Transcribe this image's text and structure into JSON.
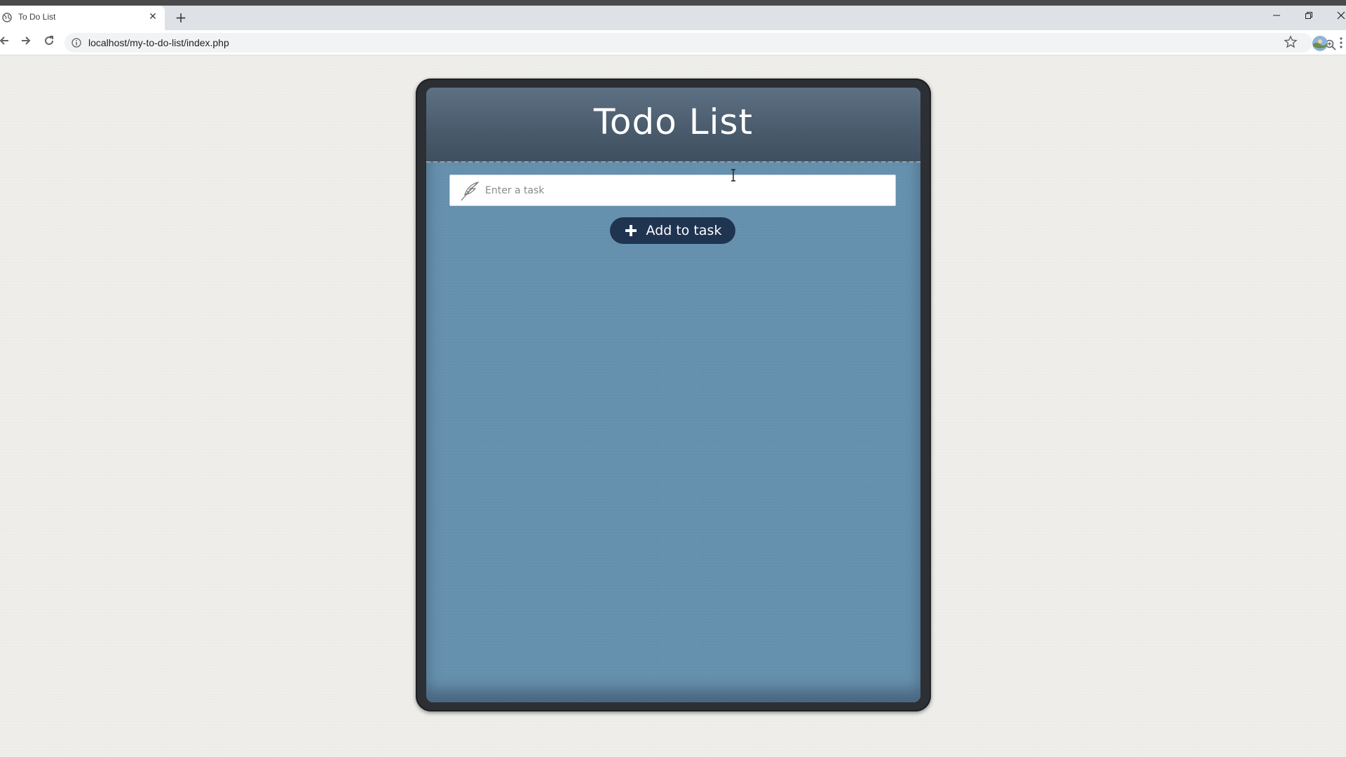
{
  "browser": {
    "tab_title": "To Do List",
    "tab_close_glyph": "✕",
    "new_tab_glyph": "+",
    "url": "localhost/my-to-do-list/index.php",
    "icons": [
      "globe-icon",
      "close-icon",
      "plus-icon",
      "minimize-icon",
      "restore-icon",
      "close-window-icon",
      "back-icon",
      "forward-icon",
      "reload-icon",
      "info-icon",
      "zoom-icon",
      "star-icon",
      "avatar-icon",
      "menu-icon"
    ]
  },
  "app": {
    "title": "Todo List",
    "input": {
      "value": "",
      "placeholder": "Enter a task",
      "icon": "feather-icon"
    },
    "add_button": {
      "label": "Add to task",
      "icon": "plus-icon"
    }
  },
  "colors": {
    "page_bg": "#efeeea",
    "card_frame": "#2c2f33",
    "header": "#4a5c6d",
    "body": "#6590ad",
    "button": "#1f3450"
  }
}
